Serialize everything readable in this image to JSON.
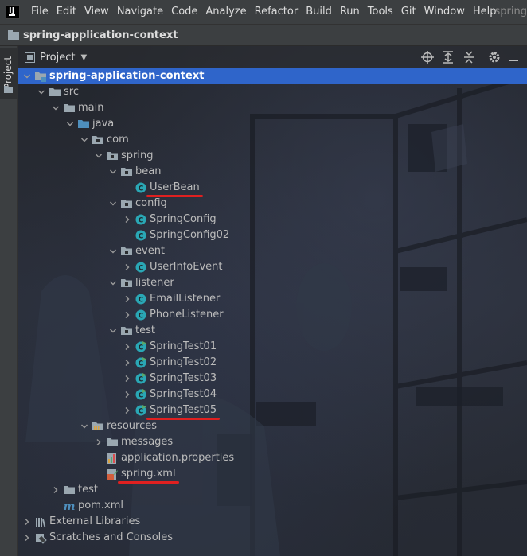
{
  "app": {
    "logo_letters": "IJ"
  },
  "menubar": {
    "items": [
      "File",
      "Edit",
      "View",
      "Navigate",
      "Code",
      "Analyze",
      "Refactor",
      "Build",
      "Run",
      "Tools",
      "Git",
      "Window",
      "Help"
    ],
    "window_title": "spring"
  },
  "breadcrumb": {
    "project": "spring-application-context"
  },
  "left_stripe": {
    "project_label": "Project"
  },
  "panel": {
    "title": "Project",
    "buttons": [
      "target-icon",
      "expand-all-icon",
      "collapse-all-icon",
      "gear-icon",
      "hide-icon"
    ]
  },
  "tree": [
    {
      "label": "spring-application-context",
      "icon": "module-folder-icon",
      "expanded": true,
      "selected": true
    },
    {
      "label": "src",
      "icon": "folder-icon",
      "expanded": true
    },
    {
      "label": "main",
      "icon": "folder-icon",
      "expanded": true
    },
    {
      "label": "java",
      "icon": "source-folder-icon",
      "expanded": true
    },
    {
      "label": "com",
      "icon": "package-icon",
      "expanded": true
    },
    {
      "label": "spring",
      "icon": "package-icon",
      "expanded": true
    },
    {
      "label": "bean",
      "icon": "package-icon",
      "expanded": true
    },
    {
      "label": "UserBean",
      "icon": "class-icon",
      "underlined": true
    },
    {
      "label": "config",
      "icon": "package-icon",
      "expanded": true
    },
    {
      "label": "SpringConfig",
      "icon": "class-icon",
      "expandable": true
    },
    {
      "label": "SpringConfig02",
      "icon": "class-icon"
    },
    {
      "label": "event",
      "icon": "package-icon",
      "expanded": true
    },
    {
      "label": "UserInfoEvent",
      "icon": "class-icon",
      "expandable": true
    },
    {
      "label": "listener",
      "icon": "package-icon",
      "expanded": true
    },
    {
      "label": "EmailListener",
      "icon": "class-icon",
      "expandable": true
    },
    {
      "label": "PhoneListener",
      "icon": "class-icon",
      "expandable": true
    },
    {
      "label": "test",
      "icon": "package-icon",
      "expanded": true
    },
    {
      "label": "SpringTest01",
      "icon": "runnable-class-icon",
      "expandable": true
    },
    {
      "label": "SpringTest02",
      "icon": "runnable-class-icon",
      "expandable": true
    },
    {
      "label": "SpringTest03",
      "icon": "runnable-class-icon",
      "expandable": true
    },
    {
      "label": "SpringTest04",
      "icon": "runnable-class-icon",
      "expandable": true
    },
    {
      "label": "SpringTest05",
      "icon": "runnable-class-icon",
      "expandable": true,
      "underlined": true
    },
    {
      "label": "resources",
      "icon": "resources-folder-icon",
      "expanded": true
    },
    {
      "label": "messages",
      "icon": "folder-icon",
      "expandable": true
    },
    {
      "label": "application.properties",
      "icon": "properties-file-icon"
    },
    {
      "label": "spring.xml",
      "icon": "spring-xml-icon",
      "underlined": true
    },
    {
      "label": "test",
      "icon": "folder-icon",
      "expandable": true
    },
    {
      "label": "pom.xml",
      "icon": "maven-icon"
    },
    {
      "label": "External Libraries",
      "icon": "libraries-icon",
      "expandable": true
    },
    {
      "label": "Scratches and Consoles",
      "icon": "scratches-icon",
      "expandable": true
    }
  ],
  "colors": {
    "selection": "#2f65ca",
    "underline": "#e02020",
    "class_icon": "#2aa7b5",
    "folder": "#9aa7b0",
    "source_folder": "#4e8fbd"
  }
}
